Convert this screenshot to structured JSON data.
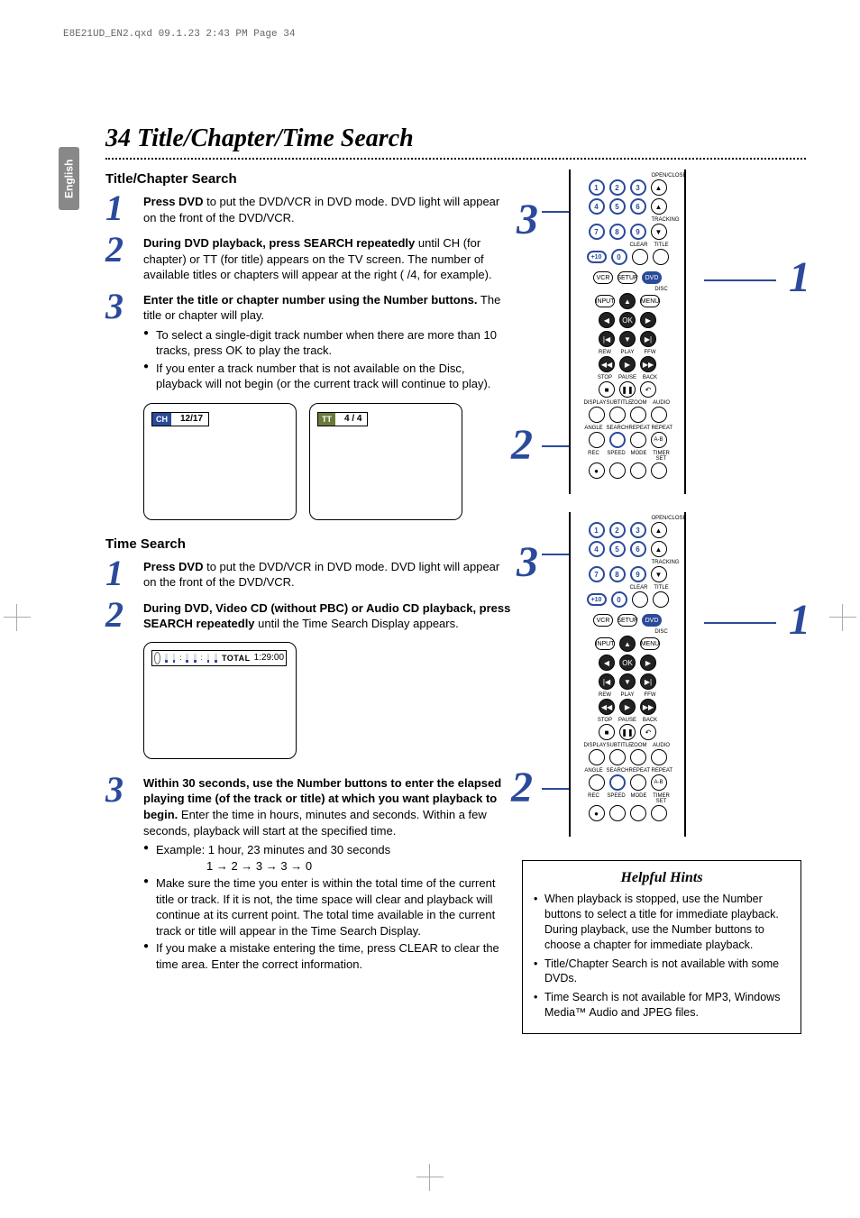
{
  "print_header": "E8E21UD_EN2.qxd  09.1.23  2:43 PM  Page 34",
  "side_tab": "English",
  "page_title": "34 Title/Chapter/Time Search",
  "section1": {
    "heading": "Title/Chapter Search",
    "steps": [
      {
        "num": "1",
        "lead_bold": "Press DVD",
        "lead_rest": " to put the DVD/VCR in DVD mode. DVD light will appear on the front of the DVD/VCR."
      },
      {
        "num": "2",
        "lead_bold": "During DVD playback, press SEARCH repeatedly",
        "lead_rest": " until CH (for chapter) or TT (for title) appears on the TV screen. The number of available titles or chapters will appear at the right (  /4, for example)."
      },
      {
        "num": "3",
        "lead_bold": "Enter the title or chapter number using the Number buttons.",
        "lead_rest": " The title or chapter will play.",
        "bullets": [
          "To select a single-digit track number when there are more than 10 tracks, press OK to play the track.",
          "If you enter a track number that is not available on the Disc, playback will not begin (or the current track will continue to play)."
        ]
      }
    ],
    "osd_ch_label": "CH",
    "osd_ch_value": "12/17",
    "osd_tt_label": "TT",
    "osd_tt_value": "4 / 4"
  },
  "section2": {
    "heading": "Time Search",
    "steps": [
      {
        "num": "1",
        "lead_bold": "Press DVD",
        "lead_rest": " to put the DVD/VCR in DVD mode. DVD light will appear on the front of the DVD/VCR."
      },
      {
        "num": "2",
        "lead_bold": "During DVD, Video CD (without PBC) or Audio CD playback, press SEARCH repeatedly",
        "lead_rest": " until the Time Search Display appears."
      },
      {
        "num": "3",
        "lead_bold": "Within 30 seconds, use the Number buttons to enter the elapsed playing time (of the track or title) at which you want playback to begin.",
        "lead_rest": " Enter the time in hours, minutes and seconds. Within a few seconds, playback will start at the specified time.",
        "bullets": [
          "Example: 1 hour, 23 minutes and 30 seconds",
          "Make sure the time you enter is within the total time of the current title or track. If it is not, the time space will clear and playback will continue at its current point. The total time available in the current track or title will appear in the Time Search Display.",
          "If you make a mistake entering the time, press CLEAR to clear the time area. Enter the correct information."
        ],
        "example_seq": "1 → 2 → 3 → 3 → 0"
      }
    ],
    "osd_total_label": "TOTAL",
    "osd_total_value": "1:29:00"
  },
  "remote": {
    "labels": {
      "open_close": "OPEN/CLOSE",
      "tracking": "TRACKING",
      "clear": "CLEAR",
      "title": "TITLE",
      "vcr": "VCR",
      "setup": "SETUP",
      "dvd": "DVD",
      "disc": "DISC",
      "input": "INPUT",
      "menu": "MENU",
      "ok": "OK",
      "rew": "REW",
      "play": "PLAY",
      "ffw": "FFW",
      "stop": "STOP",
      "pause": "PAUSE",
      "back": "BACK",
      "display": "DISPLAY",
      "subtitle": "SUBTITLE",
      "zoom": "ZOOM",
      "audio": "AUDIO",
      "angle": "ANGLE",
      "search": "SEARCH",
      "repeat": "REPEAT",
      "repeat_ab": "REPEAT",
      "ab": "A-B",
      "rec": "REC",
      "speed": "SPEED",
      "mode": "MODE",
      "timer_set": "TIMER SET",
      "plus10": "+10"
    },
    "digits": [
      "1",
      "2",
      "3",
      "4",
      "5",
      "6",
      "7",
      "8",
      "9",
      "0"
    ],
    "callouts": {
      "one": "1",
      "two": "2",
      "three": "3"
    }
  },
  "hints": {
    "title": "Helpful Hints",
    "items": [
      "When playback is stopped, use the Number buttons to select a title for immediate playback. During playback, use the Number buttons to choose a chapter for immediate playback.",
      "Title/Chapter Search is not available with some DVDs.",
      "Time Search is not available for MP3, Windows Media™ Audio and JPEG files."
    ]
  }
}
